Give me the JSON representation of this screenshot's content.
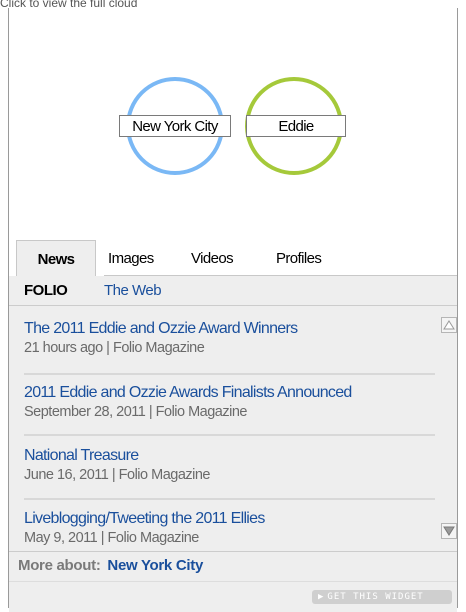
{
  "top_clipped_text": "Click to view the full cloud",
  "graph": {
    "nodes": [
      {
        "label": "New York City",
        "color": "#7ab8f5"
      },
      {
        "label": "Eddie",
        "color": "#a5c93a"
      }
    ]
  },
  "tabs": [
    {
      "label": "News",
      "active": true
    },
    {
      "label": "Images",
      "active": false
    },
    {
      "label": "Videos",
      "active": false
    },
    {
      "label": "Profiles",
      "active": false
    }
  ],
  "subtabs": {
    "folio": "FOLIO",
    "web": "The Web"
  },
  "news_items": [
    {
      "title": "The 2011 Eddie and Ozzie Award Winners",
      "meta": "21 hours ago | Folio Magazine"
    },
    {
      "title": "2011 Eddie and Ozzie Awards Finalists Announced",
      "meta": "September 28, 2011 | Folio Magazine"
    },
    {
      "title": "National Treasure",
      "meta": "June 16, 2011 | Folio Magazine"
    },
    {
      "title": "Liveblogging/Tweeting the 2011 Ellies",
      "meta": "May 9, 2011 | Folio Magazine"
    }
  ],
  "more_about": {
    "label": "More about:",
    "link": "New York City"
  },
  "widget_button": "GET THIS WIDGET",
  "colors": {
    "link": "#1a4f9c",
    "panel": "#eeeeee",
    "circle_blue": "#7ab8f5",
    "circle_green": "#a5c93a"
  }
}
